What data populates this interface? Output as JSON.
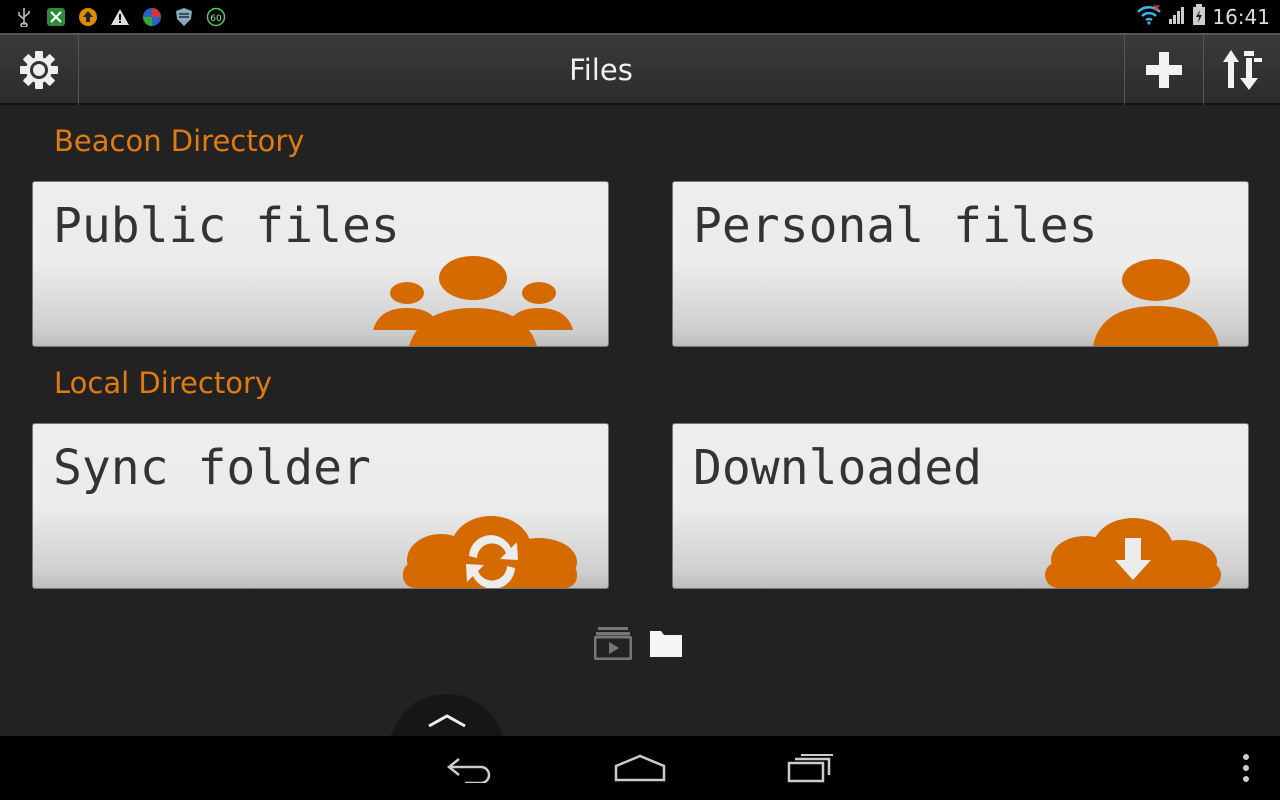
{
  "status_bar": {
    "time": "16:41",
    "notification_icons": [
      "usb-icon",
      "app-icon",
      "upload-icon",
      "warning-icon",
      "browser-icon",
      "shield-icon",
      "sixty-icon"
    ],
    "sixty_label": "60"
  },
  "action_bar": {
    "title": "Files"
  },
  "sections": {
    "beacon": {
      "label": "Beacon Directory",
      "tiles": [
        {
          "label": "Public files"
        },
        {
          "label": "Personal files"
        }
      ]
    },
    "local": {
      "label": "Local Directory",
      "tiles": [
        {
          "label": "Sync folder"
        },
        {
          "label": "Downloaded"
        }
      ]
    }
  },
  "colors": {
    "accent": "#e07b10",
    "icon_orange": "#d46a00"
  }
}
